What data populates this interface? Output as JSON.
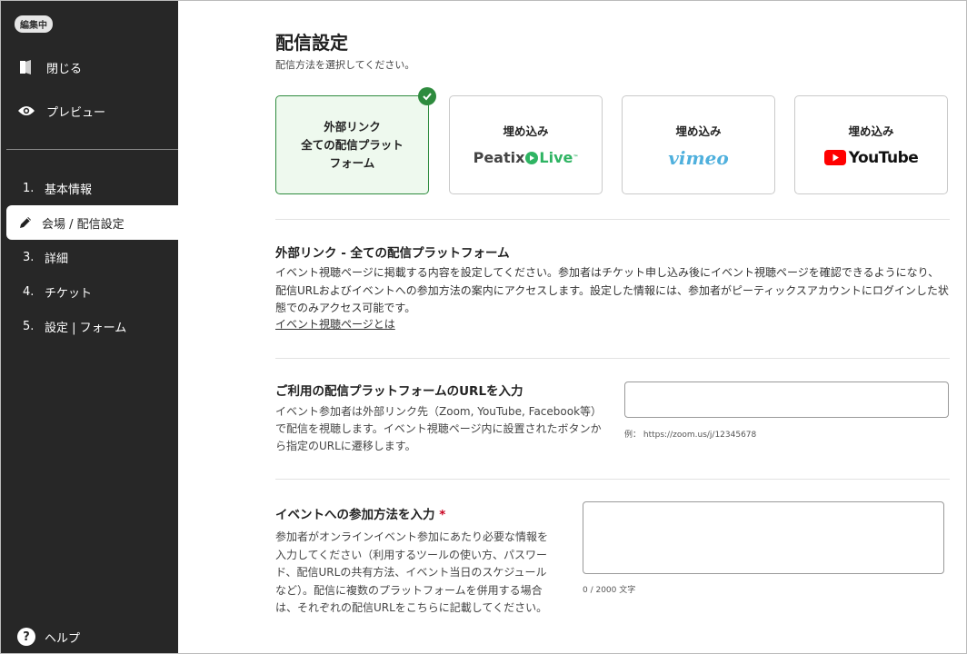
{
  "sidebar": {
    "badge": "編集中",
    "close_label": "閉じる",
    "preview_label": "プレビュー",
    "steps": [
      {
        "num": "1.",
        "label": "基本情報"
      },
      {
        "num": "",
        "label": "会場 / 配信設定"
      },
      {
        "num": "3.",
        "label": "詳細"
      },
      {
        "num": "4.",
        "label": "チケット"
      },
      {
        "num": "5.",
        "label": "設定 | フォーム"
      }
    ],
    "active_step": 1,
    "help_label": "ヘルプ"
  },
  "main": {
    "title": "配信設定",
    "subtitle": "配信方法を選択してください。",
    "cards": [
      {
        "line1": "外部リンク",
        "line2": "全ての配信プラット",
        "line3": "フォーム",
        "selected": true
      },
      {
        "label": "埋め込み",
        "logo_text": "Peatix",
        "logo_live": "Live",
        "logo_tm": "™"
      },
      {
        "label": "埋め込み",
        "logo_text": "vimeo"
      },
      {
        "label": "埋め込み",
        "logo_text": "YouTube"
      }
    ],
    "section1": {
      "title": "外部リンク - 全ての配信プラットフォーム",
      "body": "イベント視聴ページに掲載する内容を設定してください。参加者はチケット申し込み後にイベント視聴ページを確認できるようになり、配信URLおよびイベントへの参加方法の案内にアクセスします。設定した情報には、参加者がピーティックスアカウントにログインした状態でのみアクセス可能です。",
      "link": "イベント視聴ページとは"
    },
    "section2": {
      "title": "ご利用の配信プラットフォームのURLを入力",
      "body": "イベント参加者は外部リンク先（Zoom, YouTube, Facebook等）で配信を視聴します。イベント視聴ページ内に設置されたボタンから指定のURLに遷移します。",
      "input_value": "",
      "example": "例： https://zoom.us/j/12345678"
    },
    "section3": {
      "title": "イベントへの参加方法を入力",
      "required_mark": "*",
      "body": "参加者がオンラインイベント参加にあたり必要な情報を入力してください（利用するツールの使い方、パスワード、配信URLの共有方法、イベント当日のスケジュールなど）。配信に複数のプラットフォームを併用する場合は、それぞれの配信URLをこちらに記載してください。",
      "counter": "0 / 2000 文字"
    }
  },
  "colors": {
    "sidebar_bg": "#272727",
    "selected_green": "#2e8b3e",
    "required_red": "#c8001e"
  }
}
